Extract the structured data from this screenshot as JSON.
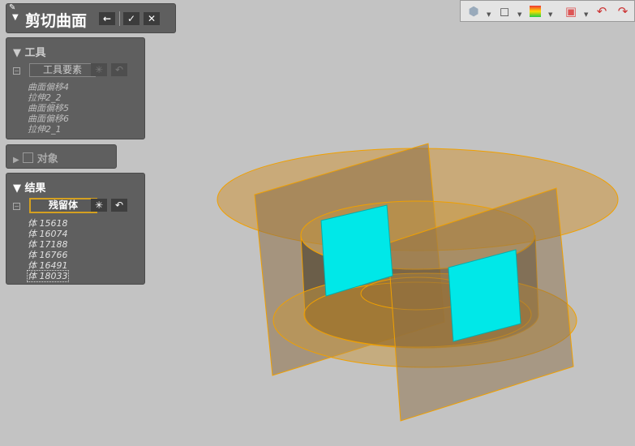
{
  "dialog": {
    "title": "剪切曲面",
    "back_label": "←",
    "ok_label": "✓",
    "cancel_label": "✕"
  },
  "tools": {
    "header": "工具",
    "selector_label": "工具要素",
    "items": [
      "曲面偏移4",
      "拉伸2_2",
      "曲面偏移5",
      "曲面偏移6",
      "拉伸2_1"
    ]
  },
  "objects": {
    "header": "对象"
  },
  "results": {
    "header": "结果",
    "selector_label": "残留体",
    "items": [
      "体 15618",
      "体 16074",
      "体 17188",
      "体 16766",
      "体 16491",
      "体 18033"
    ]
  },
  "toolbar": {
    "icons": [
      "render-style-icon",
      "view-cube-icon",
      "color-map-icon",
      "section-view-icon",
      "rotate-left-icon",
      "rotate-right-icon"
    ]
  },
  "colors": {
    "accent": "#d4a020",
    "surface": "#c89040",
    "cut_face": "#00e5e5"
  }
}
